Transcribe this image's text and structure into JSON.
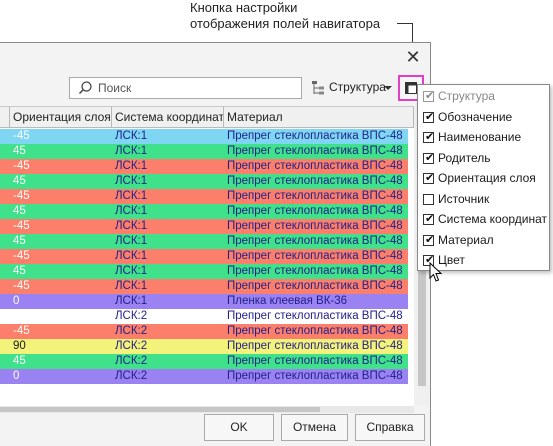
{
  "callout": {
    "line1": "Кнопка настройки",
    "line2": "отображения полей навигатора"
  },
  "dialog": {
    "close_icon": "close-icon",
    "search_placeholder": "Поиск",
    "structure_label": "Структура",
    "buttons": {
      "ok": "OK",
      "cancel": "Отмена",
      "help": "Справка"
    }
  },
  "grid": {
    "columns": [
      "Ориентация слоя",
      "Система координат",
      "Материал"
    ],
    "rows": [
      {
        "orientation": "-45",
        "cs": "ЛСК:1",
        "material": "Препрег стеклопластика ВПС-48",
        "color": "#7fd6f3"
      },
      {
        "orientation": "45",
        "cs": "ЛСК:1",
        "material": "Препрег стеклопластика ВПС-48",
        "color": "#3fe28a"
      },
      {
        "orientation": "-45",
        "cs": "ЛСК:1",
        "material": "Препрег стеклопластика ВПС-48",
        "color": "#fb7f6a"
      },
      {
        "orientation": "45",
        "cs": "ЛСК:1",
        "material": "Препрег стеклопластика ВПС-48",
        "color": "#3fe28a"
      },
      {
        "orientation": "-45",
        "cs": "ЛСК:1",
        "material": "Препрег стеклопластика ВПС-48",
        "color": "#fb7f6a"
      },
      {
        "orientation": "45",
        "cs": "ЛСК:1",
        "material": "Препрег стеклопластика ВПС-48",
        "color": "#3fe28a"
      },
      {
        "orientation": "-45",
        "cs": "ЛСК:1",
        "material": "Препрег стеклопластика ВПС-48",
        "color": "#fb7f6a"
      },
      {
        "orientation": "45",
        "cs": "ЛСК:1",
        "material": "Препрег стеклопластика ВПС-48",
        "color": "#3fe28a"
      },
      {
        "orientation": "-45",
        "cs": "ЛСК:1",
        "material": "Препрег стеклопластика ВПС-48",
        "color": "#fb7f6a"
      },
      {
        "orientation": "45",
        "cs": "ЛСК:1",
        "material": "Препрег стеклопластика ВПС-48",
        "color": "#3fe28a"
      },
      {
        "orientation": "-45",
        "cs": "ЛСК:1",
        "material": "Препрег стеклопластика ВПС-48",
        "color": "#fb7f6a"
      },
      {
        "orientation": "0",
        "cs": "ЛСК:1",
        "material": "Пленка клеевая ВК-36",
        "color": "#9b82f2"
      },
      {
        "orientation": "",
        "cs": "ЛСК:2",
        "material": "Препрег стеклопластика ВПС-48",
        "color": "#ffffff"
      },
      {
        "orientation": "-45",
        "cs": "ЛСК:2",
        "material": "Препрег стеклопластика ВПС-48",
        "color": "#fb7f6a"
      },
      {
        "orientation": "90",
        "cs": "ЛСК:2",
        "material": "Препрег стеклопластика ВПС-48",
        "color": "#f3f27a"
      },
      {
        "orientation": "45",
        "cs": "ЛСК:2",
        "material": "Препрег стеклопластика ВПС-48",
        "color": "#3fe28a"
      },
      {
        "orientation": "0",
        "cs": "ЛСК:2",
        "material": "Препрег стеклопластика ВПС-48",
        "color": "#9b82f2"
      }
    ]
  },
  "menu": {
    "items": [
      {
        "label": "Структура",
        "checked": true,
        "disabled": true
      },
      {
        "label": "Обозначение",
        "checked": true,
        "disabled": false
      },
      {
        "label": "Наименование",
        "checked": true,
        "disabled": false
      },
      {
        "label": "Родитель",
        "checked": true,
        "disabled": false
      },
      {
        "label": "Ориентация слоя",
        "checked": true,
        "disabled": false
      },
      {
        "label": "Источник",
        "checked": false,
        "disabled": false
      },
      {
        "label": "Система координат",
        "checked": true,
        "disabled": false
      },
      {
        "label": "Материал",
        "checked": true,
        "disabled": false
      },
      {
        "label": "Цвет",
        "checked": true,
        "disabled": false
      }
    ]
  },
  "colors": {
    "highlight_border": "#e040c8",
    "text_dark_blue": "#1f1f8a"
  }
}
